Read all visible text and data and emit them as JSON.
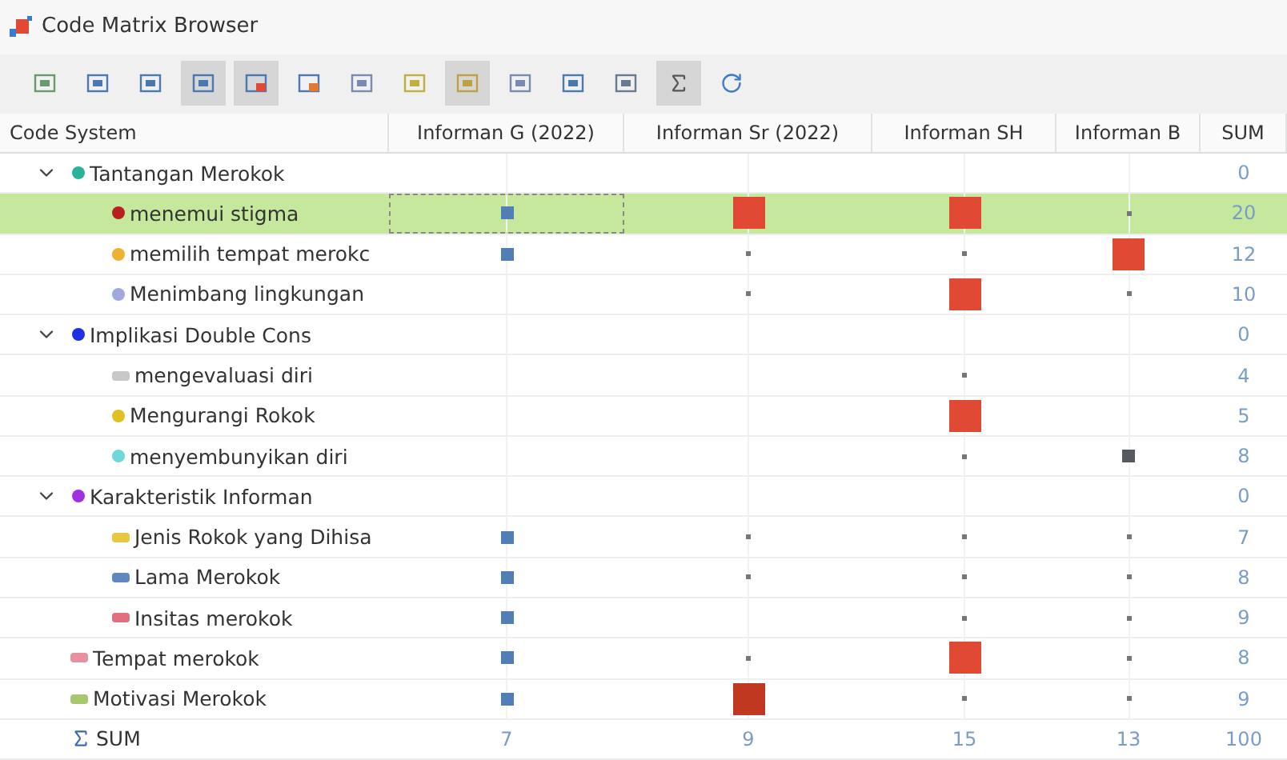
{
  "window": {
    "title": "Code Matrix Browser"
  },
  "toolbar": [
    {
      "pressed": false
    },
    {
      "pressed": false
    },
    {
      "pressed": false
    },
    {
      "pressed": true
    },
    {
      "pressed": true
    },
    {
      "pressed": false
    },
    {
      "pressed": false
    },
    {
      "pressed": false
    },
    {
      "pressed": true
    },
    {
      "pressed": false
    },
    {
      "pressed": false
    },
    {
      "pressed": false
    },
    {
      "pressed": true
    },
    {
      "pressed": false
    }
  ],
  "columns": [
    "Code System",
    "Informan G (2022)",
    "Informan Sr (2022)",
    "Informan SH",
    "Informan B",
    "SUM"
  ],
  "codes": [
    {
      "label": "Tantangan Merokok",
      "color": "#2bb39a",
      "kind": "dot",
      "expanded": true,
      "selected": false,
      "cells": [
        {
          "kind": "empty"
        },
        {
          "kind": "empty"
        },
        {
          "kind": "empty"
        },
        {
          "kind": "empty"
        }
      ],
      "sum": "0",
      "children": [
        {
          "label": "menemui stigma",
          "color": "#b52020",
          "kind": "dot",
          "selected": true,
          "cells": [
            {
              "kind": "small",
              "color": "#4f7fb5"
            },
            {
              "kind": "large",
              "color": "#e04a35"
            },
            {
              "kind": "large",
              "color": "#e04a35"
            },
            {
              "kind": "dot"
            }
          ],
          "sum": "20"
        },
        {
          "label": "memilih tempat merokc",
          "color": "#f0b030",
          "kind": "dot",
          "selected": false,
          "cells": [
            {
              "kind": "small",
              "color": "#4f7fb5"
            },
            {
              "kind": "dot"
            },
            {
              "kind": "dot"
            },
            {
              "kind": "large",
              "color": "#e04a35"
            }
          ],
          "sum": "12"
        },
        {
          "label": "Menimbang lingkungan",
          "color": "#a0a8e0",
          "kind": "dot",
          "selected": false,
          "cells": [
            {
              "kind": "empty"
            },
            {
              "kind": "dot"
            },
            {
              "kind": "large",
              "color": "#e04a35"
            },
            {
              "kind": "dot"
            }
          ],
          "sum": "10"
        }
      ]
    },
    {
      "label": "Implikasi Double Cons",
      "color": "#2030e0",
      "kind": "dot",
      "expanded": true,
      "selected": false,
      "cells": [
        {
          "kind": "empty"
        },
        {
          "kind": "empty"
        },
        {
          "kind": "empty"
        },
        {
          "kind": "empty"
        }
      ],
      "sum": "0",
      "children": [
        {
          "label": "mengevaluasi diri",
          "color": "#c8c8c8",
          "kind": "tag",
          "selected": false,
          "cells": [
            {
              "kind": "empty"
            },
            {
              "kind": "empty"
            },
            {
              "kind": "dot"
            },
            {
              "kind": "empty"
            }
          ],
          "sum": "4"
        },
        {
          "label": "Mengurangi Rokok",
          "color": "#e0c020",
          "kind": "dot",
          "selected": false,
          "cells": [
            {
              "kind": "empty"
            },
            {
              "kind": "empty"
            },
            {
              "kind": "large",
              "color": "#e04a35"
            },
            {
              "kind": "empty"
            }
          ],
          "sum": "5"
        },
        {
          "label": "menyembunyikan diri",
          "color": "#70d8d8",
          "kind": "dot",
          "selected": false,
          "cells": [
            {
              "kind": "empty"
            },
            {
              "kind": "empty"
            },
            {
              "kind": "dot"
            },
            {
              "kind": "small",
              "color": "#555a60"
            }
          ],
          "sum": "8"
        }
      ]
    },
    {
      "label": "Karakteristik Informan",
      "color": "#a030e0",
      "kind": "dot",
      "expanded": true,
      "selected": false,
      "cells": [
        {
          "kind": "empty"
        },
        {
          "kind": "empty"
        },
        {
          "kind": "empty"
        },
        {
          "kind": "empty"
        }
      ],
      "sum": "0",
      "children": [
        {
          "label": "Jenis Rokok yang Dihisa",
          "color": "#e8c840",
          "kind": "tag",
          "selected": false,
          "cells": [
            {
              "kind": "small",
              "color": "#4f7fb5"
            },
            {
              "kind": "dot"
            },
            {
              "kind": "dot"
            },
            {
              "kind": "dot"
            }
          ],
          "sum": "7"
        },
        {
          "label": "Lama Merokok",
          "color": "#6088c0",
          "kind": "tag",
          "selected": false,
          "cells": [
            {
              "kind": "small",
              "color": "#4f7fb5"
            },
            {
              "kind": "dot"
            },
            {
              "kind": "dot"
            },
            {
              "kind": "dot"
            }
          ],
          "sum": "8"
        },
        {
          "label": "Insitas merokok",
          "color": "#e07080",
          "kind": "tag",
          "selected": false,
          "cells": [
            {
              "kind": "small",
              "color": "#4f7fb5"
            },
            {
              "kind": "empty"
            },
            {
              "kind": "dot"
            },
            {
              "kind": "dot"
            }
          ],
          "sum": "9"
        }
      ]
    },
    {
      "label": "Tempat merokok",
      "color": "#e890a0",
      "kind": "tag",
      "selected": false,
      "cells": [
        {
          "kind": "small",
          "color": "#4f7fb5"
        },
        {
          "kind": "dot"
        },
        {
          "kind": "large",
          "color": "#e04a35"
        },
        {
          "kind": "dot"
        }
      ],
      "sum": "8"
    },
    {
      "label": "Motivasi  Merokok",
      "color": "#a8c870",
      "kind": "tag",
      "selected": false,
      "cells": [
        {
          "kind": "small",
          "color": "#4f7fb5"
        },
        {
          "kind": "large",
          "color": "#c03820"
        },
        {
          "kind": "dot"
        },
        {
          "kind": "dot"
        }
      ],
      "sum": "9"
    }
  ],
  "sum_row": {
    "label": "SUM",
    "values": [
      "7",
      "9",
      "15",
      "13",
      "100"
    ]
  }
}
